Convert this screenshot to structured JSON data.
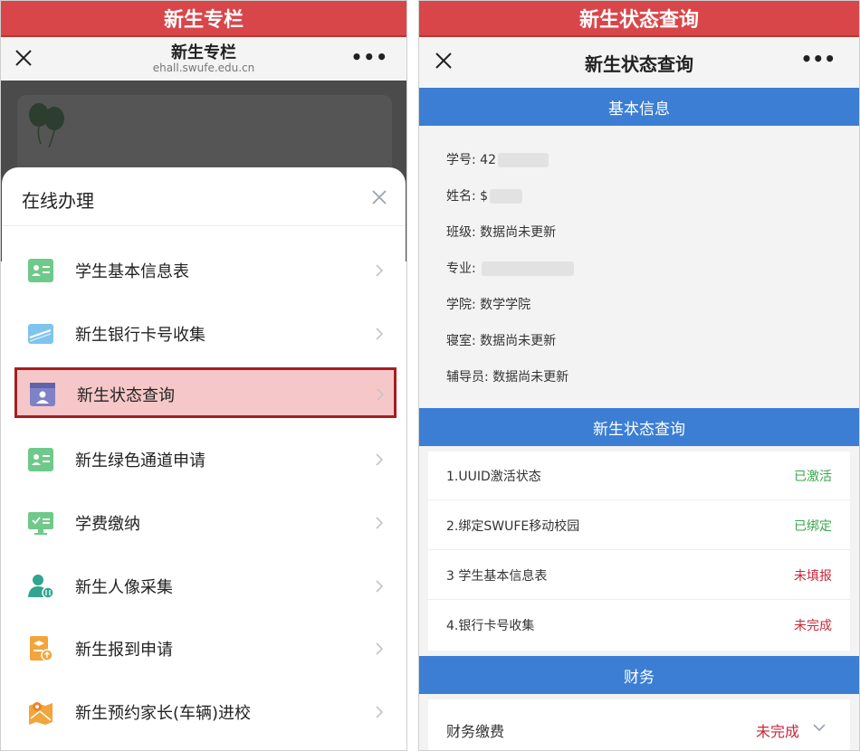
{
  "left": {
    "banner": "新生专栏",
    "titlebar": {
      "title": "新生专栏",
      "url": "ehall.swufe.edu.cn",
      "more": "•••"
    },
    "sheet_title": "在线办理",
    "items": [
      {
        "label": "学生基本信息表",
        "icon": "id-card-icon"
      },
      {
        "label": "新生银行卡号收集",
        "icon": "bank-card-icon"
      },
      {
        "label": "新生状态查询",
        "icon": "profile-window-icon"
      },
      {
        "label": "新生绿色通道申请",
        "icon": "id-card-icon"
      },
      {
        "label": "学费缴纳",
        "icon": "payment-monitor-icon"
      },
      {
        "label": "新生人像采集",
        "icon": "portrait-icon"
      },
      {
        "label": "新生报到申请",
        "icon": "report-document-icon"
      },
      {
        "label": "新生预约家长(车辆)进校",
        "icon": "map-location-icon"
      }
    ]
  },
  "right": {
    "banner": "新生状态查询",
    "titlebar": {
      "title": "新生状态查询",
      "more": "•••"
    },
    "basic_header": "基本信息",
    "basic": [
      {
        "label": "学号:",
        "value": "42"
      },
      {
        "label": "姓名:",
        "value": "$"
      },
      {
        "label": "班级:",
        "value": "数据尚未更新"
      },
      {
        "label": "专业:",
        "value": ""
      },
      {
        "label": "学院:",
        "value": "数学学院"
      },
      {
        "label": "寝室:",
        "value": "数据尚未更新"
      },
      {
        "label": "辅导员:",
        "value": "数据尚未更新"
      }
    ],
    "status_header": "新生状态查询",
    "status": [
      {
        "label": "1.UUID激活状态",
        "value": "已激活",
        "color": "#3aa64c"
      },
      {
        "label": "2.绑定SWUFE移动校园",
        "value": "已绑定",
        "color": "#3aa64c"
      },
      {
        "label": "3 学生基本信息表",
        "value": "未填报",
        "color": "#c6283b"
      },
      {
        "label": "4.银行卡号收集",
        "value": "未完成",
        "color": "#c6283b"
      }
    ],
    "finance_header": "财务",
    "finance": {
      "label": "财务缴费",
      "value": "未完成",
      "color": "#c6283b"
    }
  },
  "colors": {
    "banner": "#d9464a",
    "section_header": "#3b7ed4",
    "highlight_fill": "#f6c7c9",
    "highlight_border": "#a51e21",
    "status_green": "#3aa64c",
    "status_red": "#c6283b"
  }
}
